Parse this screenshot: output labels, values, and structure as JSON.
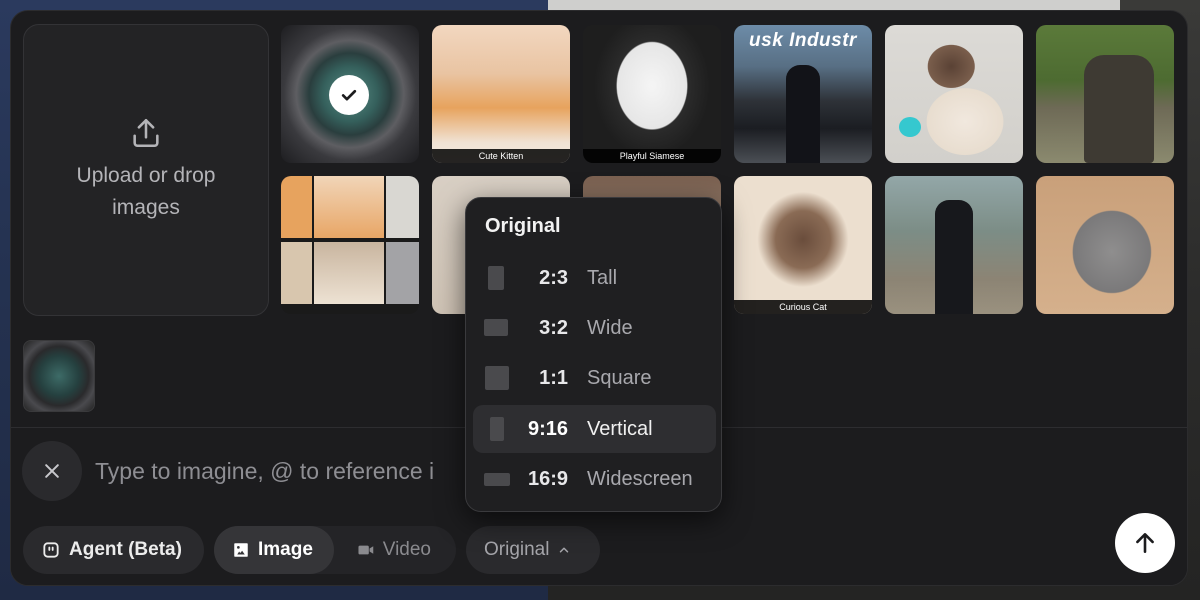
{
  "upload": {
    "label": "Upload or drop images"
  },
  "gallery": [
    {
      "caption": "",
      "selected": true,
      "style": "portal"
    },
    {
      "caption": "Cute Kitten",
      "selected": false,
      "style": "kitten"
    },
    {
      "caption": "Playful Siamese",
      "selected": false,
      "style": "mask"
    },
    {
      "caption": "",
      "selected": false,
      "style": "suit",
      "overline": "usk Industr"
    },
    {
      "caption": "",
      "selected": false,
      "style": "siamese"
    },
    {
      "caption": "",
      "selected": false,
      "style": "oldman"
    },
    {
      "caption": "",
      "selected": false,
      "style": "collage"
    },
    {
      "caption": "",
      "selected": false,
      "style": "siamese"
    },
    {
      "caption": "",
      "selected": false,
      "style": "siamese"
    },
    {
      "caption": "Curious Cat",
      "selected": false,
      "style": "siamese"
    },
    {
      "caption": "",
      "selected": false,
      "style": "suit2"
    },
    {
      "caption": "",
      "selected": false,
      "style": "grey"
    }
  ],
  "prompt": {
    "placeholder": "Type to imagine, @ to reference i"
  },
  "toolbar": {
    "agent_label": "Agent (Beta)",
    "image_label": "Image",
    "video_label": "Video",
    "ratio_label": "Original"
  },
  "dropdown": {
    "title": "Original",
    "options": [
      {
        "ratio": "2:3",
        "label": "Tall",
        "active": false
      },
      {
        "ratio": "3:2",
        "label": "Wide",
        "active": false
      },
      {
        "ratio": "1:1",
        "label": "Square",
        "active": false
      },
      {
        "ratio": "9:16",
        "label": "Vertical",
        "active": true
      },
      {
        "ratio": "16:9",
        "label": "Widescreen",
        "active": false
      }
    ]
  },
  "colors": {
    "panel": "#1c1c1e",
    "accent_white": "#ffffff",
    "muted_text": "#8e8e93"
  }
}
